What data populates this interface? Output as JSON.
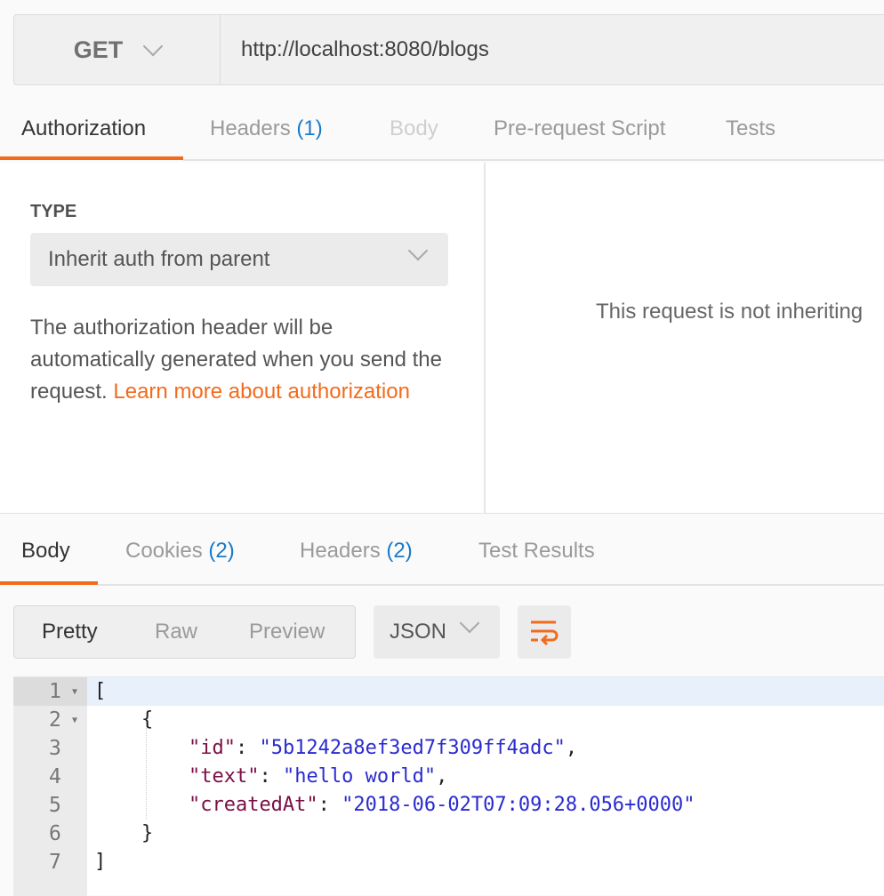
{
  "request": {
    "method": "GET",
    "url": "http://localhost:8080/blogs",
    "tabs": [
      {
        "label": "Authorization",
        "count": null,
        "state": "active"
      },
      {
        "label": "Headers",
        "count": "(1)",
        "state": "normal"
      },
      {
        "label": "Body",
        "count": null,
        "state": "disabled"
      },
      {
        "label": "Pre-request Script",
        "count": null,
        "state": "normal"
      },
      {
        "label": "Tests",
        "count": null,
        "state": "normal"
      }
    ]
  },
  "auth": {
    "type_label": "TYPE",
    "type_value": "Inherit auth from parent",
    "description": "The authorization header will be automatically generated when you send the request. ",
    "learn_more": "Learn more about authorization",
    "right_message": "This request is not inheriting"
  },
  "response": {
    "tabs": [
      {
        "label": "Body",
        "count": null
      },
      {
        "label": "Cookies",
        "count": "(2)"
      },
      {
        "label": "Headers",
        "count": "(2)"
      },
      {
        "label": "Test Results",
        "count": null
      }
    ],
    "view_modes": [
      "Pretty",
      "Raw",
      "Preview"
    ],
    "format": "JSON",
    "wrap_icon": "wrap-lines-icon",
    "lines": [
      {
        "n": "1",
        "indent": "",
        "parts": [
          [
            "p",
            "["
          ]
        ],
        "fold": true
      },
      {
        "n": "2",
        "indent": "    ",
        "parts": [
          [
            "p",
            "{"
          ]
        ],
        "fold": true
      },
      {
        "n": "3",
        "indent": "        ",
        "parts": [
          [
            "k",
            "\"id\""
          ],
          [
            "p",
            ": "
          ],
          [
            "s",
            "\"5b1242a8ef3ed7f309ff4adc\""
          ],
          [
            "p",
            ","
          ]
        ]
      },
      {
        "n": "4",
        "indent": "        ",
        "parts": [
          [
            "k",
            "\"text\""
          ],
          [
            "p",
            ": "
          ],
          [
            "s",
            "\"hello world\""
          ],
          [
            "p",
            ","
          ]
        ]
      },
      {
        "n": "5",
        "indent": "        ",
        "parts": [
          [
            "k",
            "\"createdAt\""
          ],
          [
            "p",
            ": "
          ],
          [
            "s",
            "\"2018-06-02T07:09:28.056+0000\""
          ]
        ]
      },
      {
        "n": "6",
        "indent": "    ",
        "parts": [
          [
            "p",
            "}"
          ]
        ]
      },
      {
        "n": "7",
        "indent": "",
        "parts": [
          [
            "p",
            "]"
          ]
        ]
      }
    ]
  },
  "colors": {
    "accent": "#f26b1d",
    "count": "#1a7ac8",
    "json_key": "#7a0f45",
    "json_string": "#2a2ad0"
  }
}
